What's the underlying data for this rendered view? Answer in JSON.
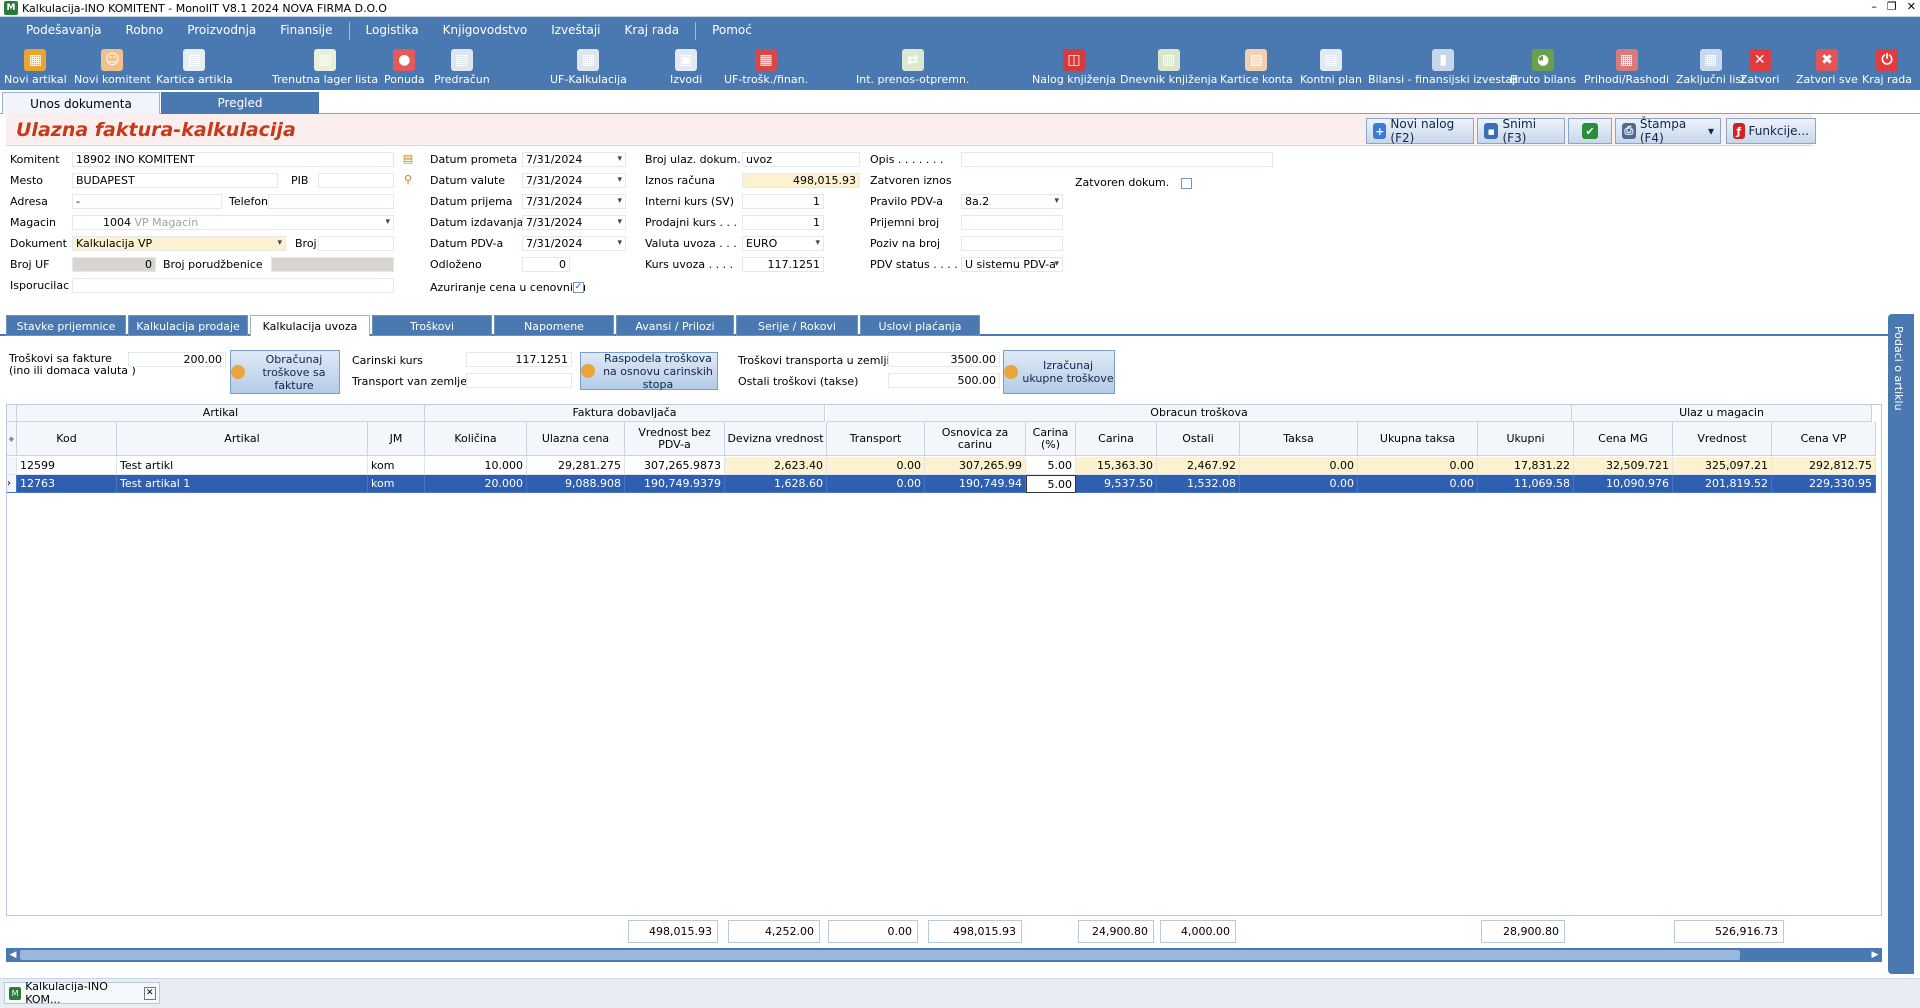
{
  "window": {
    "title": "Kalkulacija-INO KOMITENT - MonoIIT V8.1 2024 NOVA FIRMA D.O.O",
    "min": "–",
    "max": "❐",
    "close": "✕"
  },
  "menu": [
    "Podešavanja",
    "Robno",
    "Proizvodnja",
    "Finansije",
    "Logistika",
    "Knjigovodstvo",
    "Izveštaji",
    "Kraj rada",
    "Pomoć"
  ],
  "toolbar": [
    {
      "label": "Novi artikal",
      "icon": "box-icon",
      "color": "#e8a531",
      "glyph": "▦"
    },
    {
      "label": "Novi komitent",
      "icon": "person-icon",
      "color": "#f0c18a",
      "glyph": "☺"
    },
    {
      "label": "Kartica artikla",
      "icon": "calendar-icon",
      "color": "#e9eef5",
      "glyph": "▤"
    },
    {
      "label": "Trenutna lager lista",
      "icon": "sheet-icon",
      "color": "#e9f0da",
      "glyph": "▥"
    },
    {
      "label": "Ponuda",
      "icon": "offer-icon",
      "color": "#e25a5a",
      "glyph": "●"
    },
    {
      "label": "Predračun",
      "icon": "document-icon",
      "color": "#dfe6f0",
      "glyph": "▤"
    },
    {
      "label": "UF-Kalkulacija",
      "icon": "calculator-icon",
      "color": "#dfe6f0",
      "glyph": "▦"
    },
    {
      "label": "Izvodi",
      "icon": "statement-icon",
      "color": "#e3e9f2",
      "glyph": "▣"
    },
    {
      "label": "UF-trošk./finan.",
      "icon": "invoice-cost-icon",
      "color": "#d84848",
      "glyph": "▦"
    },
    {
      "label": "Int. prenos-otpremn.",
      "icon": "transfer-icon",
      "color": "#dbe9d0",
      "glyph": "⇄"
    },
    {
      "label": "Nalog knjiženja",
      "icon": "book-icon",
      "color": "#d63a3a",
      "glyph": "◫"
    },
    {
      "label": "Dnevnik knjiženja",
      "icon": "journal-icon",
      "color": "#d9e6cc",
      "glyph": "▥"
    },
    {
      "label": "Kartice konta",
      "icon": "cards-icon",
      "color": "#f3d0b0",
      "glyph": "▧"
    },
    {
      "label": "Kontni plan",
      "icon": "plan-icon",
      "color": "#e2e9f3",
      "glyph": "▤"
    },
    {
      "label": "Bilansi - finansijski izvestaji",
      "icon": "bars-icon",
      "color": "#c8d6ea",
      "glyph": "▮"
    },
    {
      "label": "Bruto bilans",
      "icon": "globe-chart-icon",
      "color": "#6aa04a",
      "glyph": "◕"
    },
    {
      "label": "Prihodi/Rashodi",
      "icon": "income-icon",
      "color": "#d97a7a",
      "glyph": "▦"
    },
    {
      "label": "Zaključni list",
      "icon": "final-sheet-icon",
      "color": "#c9d8ec",
      "glyph": "▦"
    },
    {
      "label": "Zatvori",
      "icon": "close-icon",
      "color": "#e23b3b",
      "glyph": "✕"
    },
    {
      "label": "Zatvori sve",
      "icon": "close-all-icon",
      "color": "#e25555",
      "glyph": "✖"
    },
    {
      "label": "Kraj rada",
      "icon": "power-icon",
      "color": "#e23b3b",
      "glyph": "⏻"
    }
  ],
  "toptabs": [
    "Unos dokumenta",
    "Pregled"
  ],
  "header": {
    "title": "Ulazna faktura-kalkulacija",
    "buttons": [
      {
        "label": "Novi nalog (F2)",
        "icon": "new-order-icon",
        "color": "#3a7bd5",
        "glyph": "+"
      },
      {
        "label": "Snimi (F3)",
        "icon": "save-icon",
        "color": "#3a6fb5",
        "glyph": "▪"
      },
      {
        "label": "",
        "icon": "checkmark-icon",
        "color": "#2e8b3a",
        "glyph": "✔"
      },
      {
        "label": "Štampa (F4)",
        "icon": "print-icon",
        "color": "#4c6a93",
        "glyph": "⎙"
      },
      {
        "label": "Funkcije...",
        "icon": "functions-icon",
        "color": "#d32020",
        "glyph": "ƒ"
      }
    ]
  },
  "form": {
    "komitent_label": "Komitent",
    "komitent": "18902 INO KOMITENT",
    "mesto_label": "Mesto",
    "mesto": "BUDAPEST",
    "pib_label": "PIB",
    "pib": "",
    "adresa_label": "Adresa",
    "adresa": "-",
    "telefon_label": "Telefon",
    "telefon": "",
    "magacin_label": "Magacin",
    "magacin_code": "1004",
    "magacin_name": "VP Magacin",
    "dokument_label": "Dokument",
    "dokument": "Kalkulacija VP",
    "broj_label": "Broj",
    "broj": "",
    "broj_uf_label": "Broj UF",
    "broj_uf": "0",
    "broj_porudzbenice_label": "Broj porudžbenice",
    "broj_porudzbenice": "",
    "isporucilac_label": "Isporucilac",
    "isporucilac": "",
    "datum_prometa_label": "Datum prometa",
    "datum_prometa": "7/31/2024",
    "datum_valute_label": "Datum valute",
    "datum_valute": "7/31/2024",
    "datum_prijema_label": "Datum prijema",
    "datum_prijema": "7/31/2024",
    "datum_izdavanja_label": "Datum izdavanja",
    "datum_izdavanja": "7/31/2024",
    "datum_pdv_label": "Datum PDV-a",
    "datum_pdv": "7/31/2024",
    "odlozeno_label": "Odloženo",
    "odlozeno": "0",
    "azuriranje_label": "Azuriranje cena u cenovniku",
    "azuriranje_checked": "✓",
    "broj_ulaz_label": "Broj ulaz. dokum.",
    "broj_ulaz": "uvoz",
    "iznos_racuna_label": "Iznos računa",
    "iznos_racuna": "498,015.93",
    "interni_kurs_label": "Interni kurs (SV)",
    "interni_kurs": "1",
    "prodajni_kurs_label": "Prodajni kurs . . .",
    "prodajni_kurs": "1",
    "valuta_uvoza_label": "Valuta uvoza . . .",
    "valuta_uvoza": "EURO",
    "kurs_uvoza_label": "Kurs uvoza . . . .",
    "kurs_uvoza": "117.1251",
    "opis_label": "Opis . . . . . . .",
    "opis": "",
    "zatvoren_iznos_label": "Zatvoren iznos",
    "zatvoren_dokum_label": "Zatvoren dokum.",
    "pravilo_pdv_label": "Pravilo PDV-a",
    "pravilo_pdv": "8a.2",
    "prijemni_broj_label": "Prijemni broj",
    "prijemni_broj": "",
    "poziv_label": "Poziv na broj",
    "poziv": "",
    "pdv_status_label": "PDV status . . . .",
    "pdv_status": "U sistemu PDV-a"
  },
  "subtabs": [
    "Stavke prijemnice",
    "Kalkulacija prodaje",
    "Kalkulacija uvoza",
    "Troškovi",
    "Napomene",
    "Avansi / Prilozi",
    "Serije / Rokovi trajanja",
    "Uslovi plaćanja"
  ],
  "calc": {
    "troskovi_fakture_label": "Troškovi sa fakture",
    "troskovi_fakture_sub": "(ino ili domaca valuta )",
    "troskovi_fakture": "200.00",
    "obracunaj_btn": "Obračunaj troškove sa fakture",
    "carinski_kurs_label": "Carinski kurs",
    "carinski_kurs": "117.1251",
    "transport_van_label": "Transport van zemlje",
    "transport_van": "",
    "raspodela_btn": "Raspodela troškova na osnovu carinskih stopa",
    "troskovi_transporta_label": "Troškovi transporta u zemlji",
    "troskovi_transporta": "3500.00",
    "ostali_troskovi_label": "Ostali troškovi (takse)",
    "ostali_troskovi": "500.00",
    "izracunaj_btn": "Izračunaj ukupne troškove"
  },
  "grid": {
    "groups": [
      "Artikal",
      "Faktura dobavljača",
      "Obracun troškova",
      "Ulaz u magacin"
    ],
    "columns": [
      "Kod",
      "Artikal",
      "JM",
      "Količina",
      "Ulazna cena",
      "Vrednost bez PDV-a",
      "Devizna vrednost",
      "Transport",
      "Osnovica za carinu",
      "Carina (%)",
      "Carina",
      "Ostali",
      "Taksa",
      "Ukupna taksa",
      "Ukupni",
      "Cena MG",
      "Vrednost",
      "Cena VP"
    ],
    "rows": [
      [
        "12599",
        "Test artikl",
        "kom",
        "10.000",
        "29,281.275",
        "307,265.9873",
        "2,623.40",
        "0.00",
        "307,265.99",
        "5.00",
        "15,363.30",
        "2,467.92",
        "0.00",
        "0.00",
        "17,831.22",
        "32,509.721",
        "325,097.21",
        "292,812.75"
      ],
      [
        "12763",
        "Test artikal 1",
        "kom",
        "20.000",
        "9,088.908",
        "190,749.9379",
        "1,628.60",
        "0.00",
        "190,749.94",
        "5.00",
        "9,537.50",
        "1,532.08",
        "0.00",
        "0.00",
        "11,069.58",
        "10,090.976",
        "201,819.52",
        "229,330.95"
      ]
    ],
    "totals": [
      "498,015.93",
      "4,252.00",
      "0.00",
      "498,015.93",
      "24,900.80",
      "4,000.00",
      "28,900.80",
      "526,916.73"
    ],
    "row_marker": "◆",
    "current_marker": "›"
  },
  "sidepanel": "Podaci o artiklu",
  "taskbar": {
    "tab": "Kalkulacija-INO KOM...",
    "close": "✕"
  },
  "colors": {
    "menu": "#4a78b0",
    "title_red": "#c63a1a",
    "selection": "#2f5fb0",
    "yellow": "#fdf2cf"
  }
}
